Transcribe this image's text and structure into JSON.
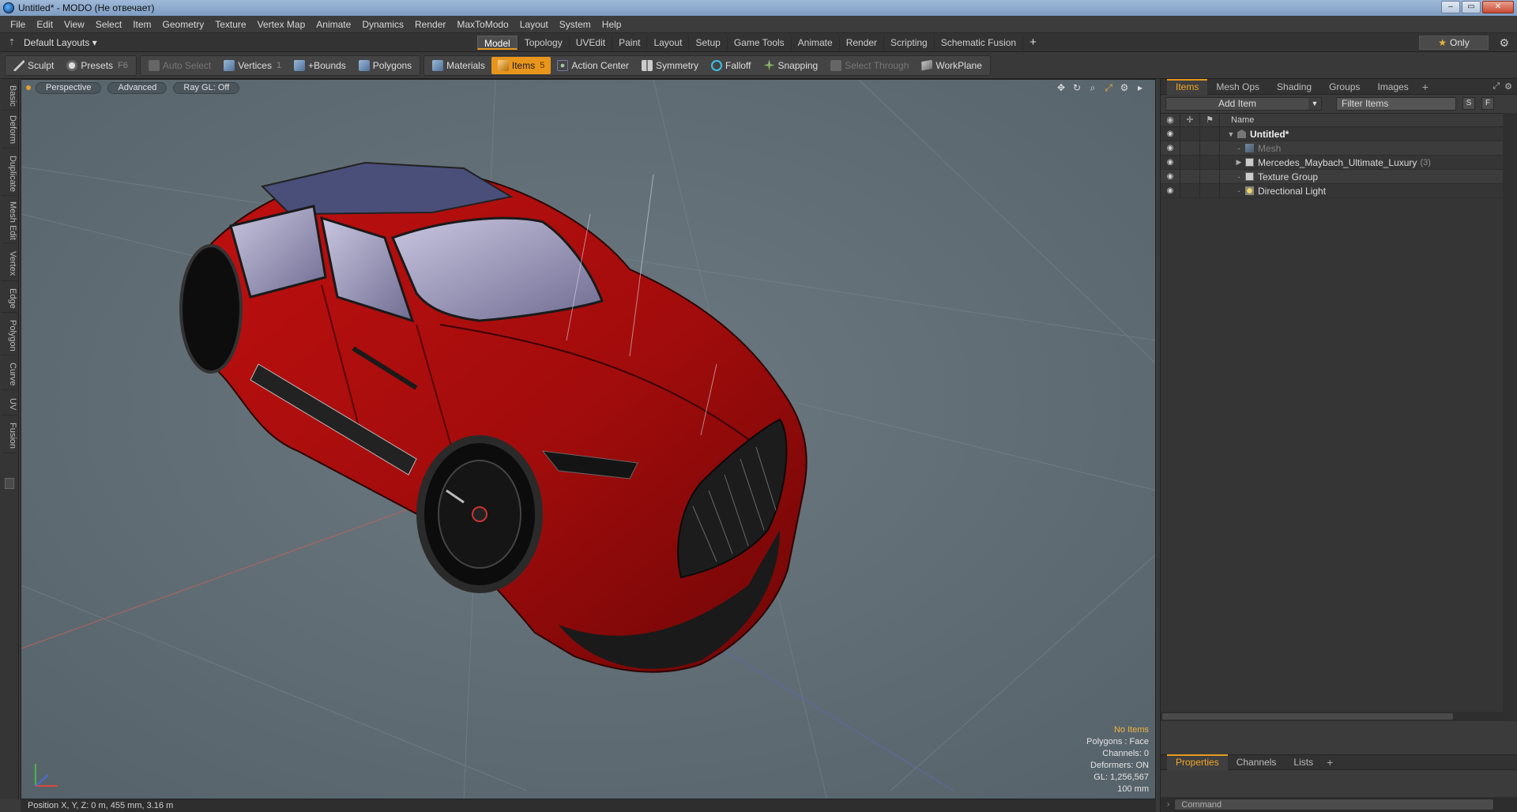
{
  "window": {
    "title": "Untitled* - MODO (Не отвечает)",
    "buttons": [
      "–",
      "▭",
      "✕"
    ]
  },
  "menu": [
    "File",
    "Edit",
    "View",
    "Select",
    "Item",
    "Geometry",
    "Texture",
    "Vertex Map",
    "Animate",
    "Dynamics",
    "Render",
    "MaxToModo",
    "Layout",
    "System",
    "Help"
  ],
  "layout": {
    "selector": "Default Layouts ▾",
    "tabs": [
      "Model",
      "Topology",
      "UVEdit",
      "Paint",
      "Layout",
      "Setup",
      "Game Tools",
      "Animate",
      "Render",
      "Scripting",
      "Schematic Fusion",
      "+"
    ],
    "active_tab": "Model",
    "only_label": "Only"
  },
  "toolbar": {
    "sculpt": "Sculpt",
    "presets": "Presets",
    "presets_key": "F6",
    "auto_select": "Auto Select",
    "vertices": "Vertices",
    "vertices_key": "1",
    "bounds": "+Bounds",
    "polygons": "Polygons",
    "materials": "Materials",
    "items": "Items",
    "items_key": "5",
    "action_center": "Action Center",
    "symmetry": "Symmetry",
    "falloff": "Falloff",
    "snapping": "Snapping",
    "select_through": "Select Through",
    "workplane": "WorkPlane"
  },
  "left_tabs": [
    "Basic",
    "Deform",
    "Duplicate",
    "Mesh Edit",
    "Vertex",
    "Edge",
    "Polygon",
    "Curve",
    "UV",
    "Fusion"
  ],
  "viewport": {
    "view": "Perspective",
    "shading": "Advanced",
    "raygl": "Ray GL: Off",
    "stats": {
      "selection": "No Items",
      "polygons": "Polygons : Face",
      "channels": "Channels: 0",
      "deformers": "Deformers: ON",
      "gl": "GL: 1,256,567",
      "scale": "100 mm"
    }
  },
  "status": "Position X, Y, Z:   0 m, 455 mm, 3.16 m",
  "items_panel": {
    "tabs": [
      "Items",
      "Mesh Ops",
      "Shading",
      "Groups",
      "Images",
      "+"
    ],
    "add_item": "Add Item",
    "filter_placeholder": "Filter Items",
    "btn_s": "S",
    "btn_f": "F",
    "col_name": "Name",
    "tree": [
      {
        "label": "Untitled*",
        "bold": true,
        "twirl": "▼",
        "icon": "scene-icon",
        "level": 0
      },
      {
        "label": "Mesh",
        "dim": true,
        "twirl": "",
        "icon": "mesh-icon",
        "level": 1
      },
      {
        "label": "Mercedes_Maybach_Ultimate_Luxury",
        "count": "(3)",
        "twirl": "▶",
        "icon": "group-icon",
        "level": 1
      },
      {
        "label": "Texture Group",
        "twirl": "",
        "icon": "group-icon",
        "level": 1
      },
      {
        "label": "Directional Light",
        "twirl": "",
        "icon": "light-icon",
        "level": 1
      }
    ]
  },
  "properties_panel": {
    "tabs": [
      "Properties",
      "Channels",
      "Lists",
      "+"
    ]
  },
  "command": {
    "placeholder": "Command"
  }
}
